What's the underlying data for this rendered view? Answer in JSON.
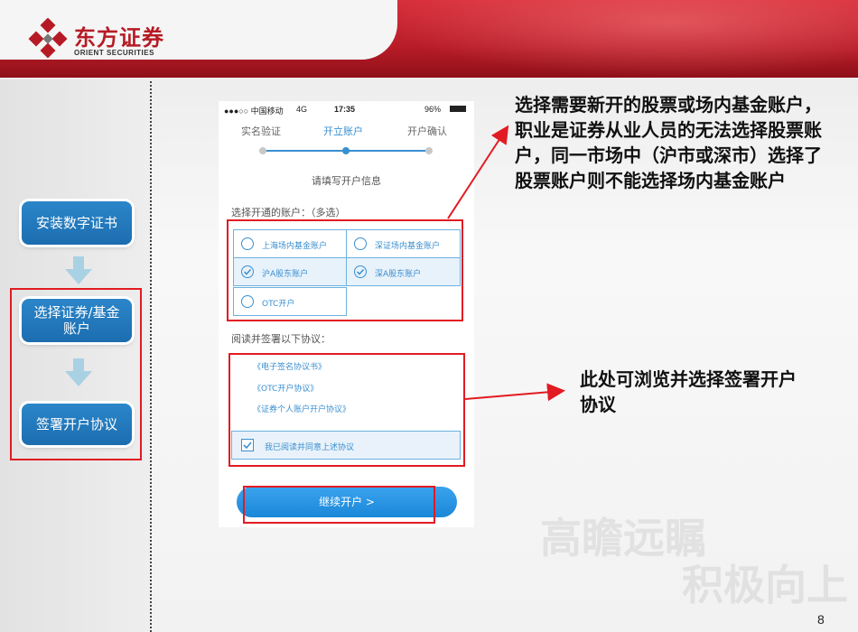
{
  "brand": {
    "name_cn": "东方证券",
    "name_en": "ORIENT SECURITIES"
  },
  "flow_steps": [
    {
      "label": "安装数字证书"
    },
    {
      "label": "选择证券/基金账户"
    },
    {
      "label": "签署开户协议"
    }
  ],
  "phone": {
    "status": {
      "carrier": "●●●○○ 中国移动",
      "network": "4G",
      "time": "17:35",
      "battery": "96%"
    },
    "progress_steps": [
      "实名验证",
      "开立账户",
      "开户确认"
    ],
    "active_step_index": 1,
    "subtitle": "请填写开户信息",
    "accounts_label": "选择开通的账户：（多选）",
    "accounts": [
      {
        "label": "上海场内基金账户",
        "checked": false
      },
      {
        "label": "深证场内基金账户",
        "checked": false
      },
      {
        "label": "沪A股东账户",
        "checked": true
      },
      {
        "label": "深A股东账户",
        "checked": true
      },
      {
        "label": "OTC开户",
        "checked": false
      }
    ],
    "agreements_label": "阅读并签署以下协议：",
    "agreements": [
      "《电子签名协议书》",
      "《OTC开户协议》",
      "《证券个人账户开户协议》"
    ],
    "agree_text": "我已阅读并同意上述协议",
    "agree_checked": true,
    "continue_button": "继续开户 >"
  },
  "annotations": {
    "accounts_note": "选择需要新开的股票或场内基金账户，职业是证券从业人员的无法选择股票账户，同一市场中（沪市或深市）选择了股票账户则不能选择场内基金账户",
    "agreements_note": "此处可浏览并选择签署开户协议"
  },
  "watermark": {
    "line1": "高瞻远瞩",
    "line2": "积极向上"
  },
  "page_number": "8",
  "colors": {
    "brand_red": "#c8202c",
    "step_blue": "#1f74b8",
    "accent_blue": "#3a8fd0",
    "highlight_red": "#e21b22"
  }
}
